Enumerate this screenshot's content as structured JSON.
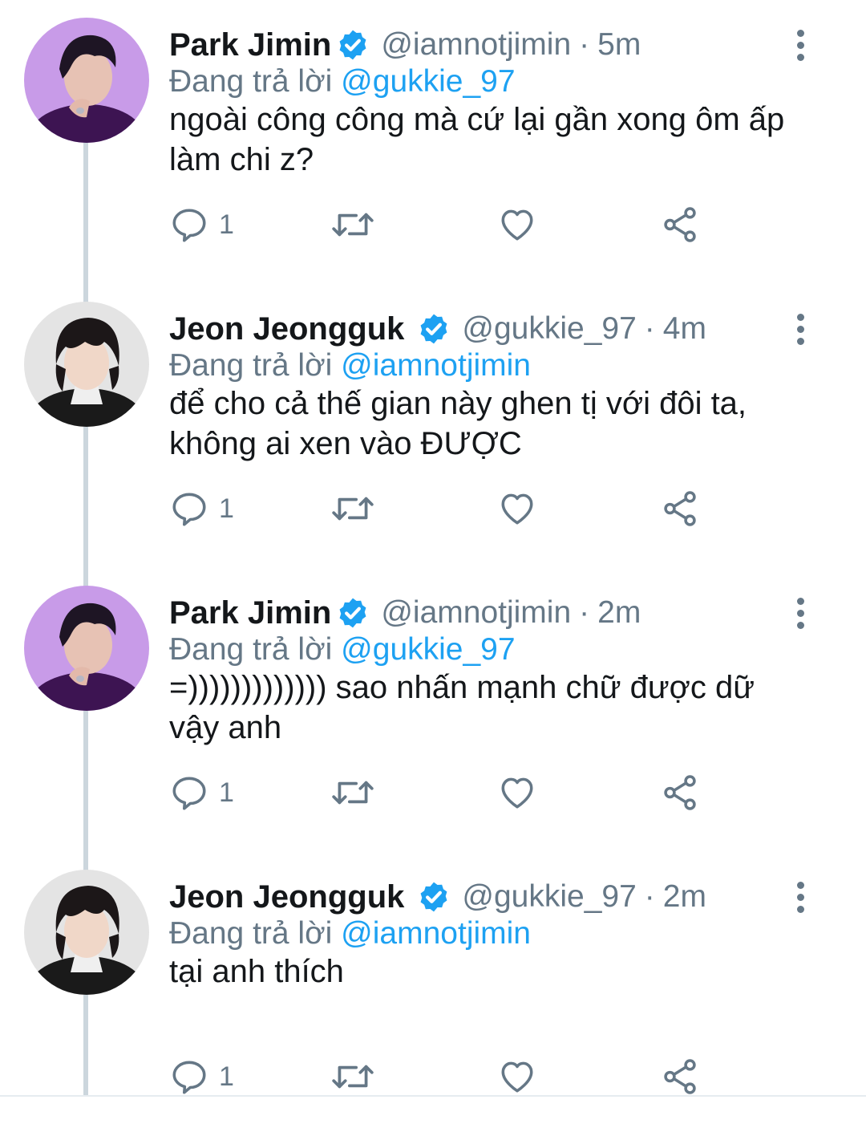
{
  "colors": {
    "accent": "#1da1f2",
    "text_primary": "#14171a",
    "text_secondary": "#657786",
    "thread_line": "#ccd6dd"
  },
  "tweets": [
    {
      "name": "Park Jimin",
      "handle": "@iamnotjimin",
      "dot": "·",
      "time": "5m",
      "reply_prefix": "Đang trả lời",
      "reply_to": "@gukkie_97",
      "text": "ngoài công công mà cứ lại gần xong ôm ấp làm chi z?",
      "reply_count": "1",
      "avatar": "purple-background-avatar",
      "icons": [
        "verified-icon",
        "more-icon",
        "reply-icon",
        "retweet-icon",
        "like-icon",
        "share-icon"
      ]
    },
    {
      "name": "Jeon Jeongguk",
      "handle": "@gukkie_97",
      "dot": "·",
      "time": "4m",
      "reply_prefix": "Đang trả lời",
      "reply_to": "@iamnotjimin",
      "text": "để cho cả thế gian này ghen tị với đôi ta, không ai xen vào ĐƯỢC",
      "reply_count": "1",
      "avatar": "grey-background-avatar",
      "icons": [
        "verified-icon",
        "more-icon",
        "reply-icon",
        "retweet-icon",
        "like-icon",
        "share-icon"
      ]
    },
    {
      "name": "Park Jimin",
      "handle": "@iamnotjimin",
      "dot": "·",
      "time": "2m",
      "reply_prefix": "Đang trả lời",
      "reply_to": "@gukkie_97",
      "text": "=))))))))))))) sao nhấn mạnh chữ được dữ vậy anh",
      "reply_count": "1",
      "avatar": "purple-background-avatar",
      "icons": [
        "verified-icon",
        "more-icon",
        "reply-icon",
        "retweet-icon",
        "like-icon",
        "share-icon"
      ]
    },
    {
      "name": "Jeon Jeongguk",
      "handle": "@gukkie_97",
      "dot": "·",
      "time": "2m",
      "reply_prefix": "Đang trả lời",
      "reply_to": "@iamnotjimin",
      "text": "tại anh thích",
      "reply_count": "1",
      "avatar": "grey-background-avatar",
      "icons": [
        "verified-icon",
        "more-icon",
        "reply-icon",
        "retweet-icon",
        "like-icon",
        "share-icon"
      ]
    }
  ]
}
